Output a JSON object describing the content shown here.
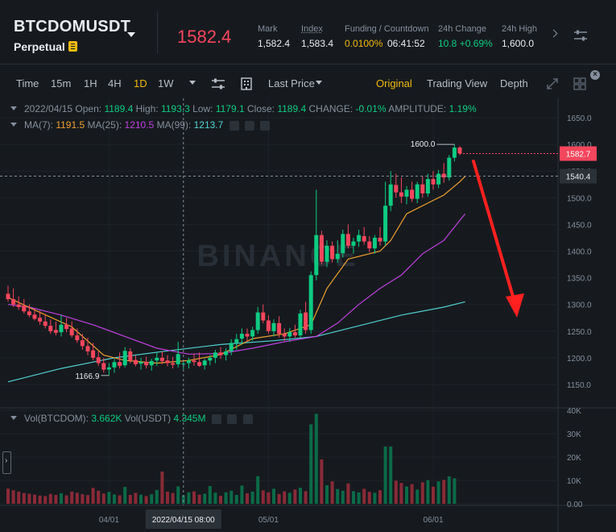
{
  "header": {
    "symbol": "BTCDOMUSDT",
    "contract_type": "Perpetual",
    "last_price": "1582.4",
    "stats": [
      {
        "label": "Mark",
        "value": "1,582.4"
      },
      {
        "label": "Index",
        "value": "1,583.4"
      },
      {
        "label": "Funding / Countdown",
        "value": "0.0100%",
        "value2": "06:41:52"
      },
      {
        "label": "24h Change",
        "value": "10.8 +0.69%"
      },
      {
        "label": "24h High",
        "value": "1,600.0"
      }
    ]
  },
  "toolbar": {
    "intervals": [
      "Time",
      "15m",
      "1H",
      "4H",
      "1D",
      "1W"
    ],
    "active_interval": "1D",
    "price_type": "Last Price",
    "views": [
      "Original",
      "Trading View",
      "Depth"
    ],
    "active_view": "Original"
  },
  "legend": {
    "date": "2022/04/15",
    "open_label": "Open:",
    "open": "1189.4",
    "high_label": "High:",
    "high": "1193.3",
    "low_label": "Low:",
    "low": "1179.1",
    "close_label": "Close:",
    "close": "1189.4",
    "change_label": "CHANGE:",
    "change": "-0.01%",
    "amplitude_label": "AMPLITUDE:",
    "amplitude": "1.19%",
    "ma7_label": "MA(7):",
    "ma7": "1191.5",
    "ma25_label": "MA(25):",
    "ma25": "1210.5",
    "ma99_label": "MA(99):",
    "ma99": "1213.7",
    "vol_label": "Vol(BTCDOM):",
    "vol_btcdom": "3.662K",
    "vol_usdt_label": "Vol(USDT)",
    "vol_usdt": "4.345M"
  },
  "watermark": "BINANCE",
  "markers": {
    "high_label": "1600.0",
    "low_label": "1166.9",
    "current_price_tag": "1582.7",
    "crosshair_price_tag": "1540.4",
    "crosshair_date_tag": "2022/04/15 08:00"
  },
  "colors": {
    "up": "#0ecb81",
    "down": "#f6465d",
    "ma7": "#f0a030",
    "ma25": "#c040e0",
    "ma99": "#50d0d0",
    "annotation_arrow": "#ff2020"
  },
  "chart_data": {
    "type": "candlestick",
    "ylim": [
      1130,
      1670
    ],
    "y_ticks": [
      "1650.0",
      "1600.0",
      "1550.0",
      "1500.0",
      "1450.0",
      "1400.0",
      "1350.0",
      "1300.0",
      "1250.0",
      "1200.0",
      "1150.0"
    ],
    "y_tick_values": [
      1650,
      1600,
      1550,
      1500,
      1450,
      1400,
      1350,
      1300,
      1250,
      1200,
      1150
    ],
    "vol_ticks": [
      "40K",
      "30K",
      "20K",
      "10K",
      "0.00"
    ],
    "vol_tick_values": [
      40000,
      30000,
      20000,
      10000,
      0
    ],
    "x_ticks": [
      {
        "label": "04/01",
        "index": 19
      },
      {
        "label": "05/01",
        "index": 49
      },
      {
        "label": "06/01",
        "index": 80
      }
    ],
    "highlighted_index": 33,
    "candles": [
      [
        1320,
        1335,
        1305,
        1310,
        6500
      ],
      [
        1310,
        1330,
        1295,
        1300,
        5800
      ],
      [
        1300,
        1315,
        1290,
        1295,
        5200
      ],
      [
        1298,
        1310,
        1283,
        1287,
        4600
      ],
      [
        1287,
        1300,
        1276,
        1280,
        4300
      ],
      [
        1281,
        1292,
        1270,
        1273,
        3900
      ],
      [
        1275,
        1288,
        1262,
        1268,
        3500
      ],
      [
        1268,
        1282,
        1255,
        1260,
        3300
      ],
      [
        1260,
        1272,
        1245,
        1250,
        4200
      ],
      [
        1252,
        1268,
        1242,
        1247,
        3800
      ],
      [
        1248,
        1280,
        1240,
        1262,
        4500
      ],
      [
        1262,
        1275,
        1248,
        1254,
        3600
      ],
      [
        1255,
        1268,
        1238,
        1242,
        5200
      ],
      [
        1242,
        1255,
        1228,
        1233,
        4700
      ],
      [
        1233,
        1245,
        1215,
        1222,
        4100
      ],
      [
        1222,
        1238,
        1205,
        1212,
        3700
      ],
      [
        1214,
        1228,
        1195,
        1200,
        6800
      ],
      [
        1201,
        1212,
        1185,
        1190,
        5600
      ],
      [
        1190,
        1200,
        1172,
        1178,
        4400
      ],
      [
        1178,
        1190,
        1167,
        1182,
        5100
      ],
      [
        1182,
        1198,
        1172,
        1192,
        4000
      ],
      [
        1192,
        1210,
        1180,
        1185,
        3600
      ],
      [
        1186,
        1220,
        1182,
        1213,
        7200
      ],
      [
        1212,
        1218,
        1190,
        1195,
        3800
      ],
      [
        1196,
        1205,
        1184,
        1188,
        4700
      ],
      [
        1189,
        1200,
        1178,
        1192,
        3900
      ],
      [
        1192,
        1202,
        1180,
        1186,
        3300
      ],
      [
        1186,
        1198,
        1176,
        1194,
        4100
      ],
      [
        1195,
        1210,
        1185,
        1200,
        5900
      ],
      [
        1200,
        1212,
        1188,
        1194,
        13800
      ],
      [
        1195,
        1205,
        1184,
        1190,
        5200
      ],
      [
        1190,
        1202,
        1180,
        1187,
        4600
      ],
      [
        1188,
        1230,
        1182,
        1207,
        7400
      ],
      [
        1189,
        1193,
        1179,
        1189,
        3662
      ],
      [
        1190,
        1200,
        1180,
        1195,
        4900
      ],
      [
        1195,
        1208,
        1185,
        1192,
        5300
      ],
      [
        1192,
        1210,
        1183,
        1185,
        3900
      ],
      [
        1186,
        1198,
        1178,
        1195,
        4300
      ],
      [
        1195,
        1205,
        1186,
        1200,
        7600
      ],
      [
        1200,
        1215,
        1190,
        1210,
        4800
      ],
      [
        1210,
        1220,
        1198,
        1205,
        3400
      ],
      [
        1205,
        1218,
        1195,
        1212,
        4900
      ],
      [
        1212,
        1235,
        1205,
        1228,
        5600
      ],
      [
        1228,
        1245,
        1215,
        1235,
        3800
      ],
      [
        1236,
        1255,
        1225,
        1245,
        7800
      ],
      [
        1245,
        1255,
        1230,
        1240,
        4500
      ],
      [
        1240,
        1258,
        1232,
        1252,
        5200
      ],
      [
        1252,
        1295,
        1245,
        1285,
        11800
      ],
      [
        1285,
        1300,
        1265,
        1270,
        5800
      ],
      [
        1270,
        1280,
        1245,
        1250,
        4900
      ],
      [
        1250,
        1272,
        1240,
        1265,
        6400
      ],
      [
        1265,
        1278,
        1238,
        1245,
        4200
      ],
      [
        1245,
        1255,
        1232,
        1240,
        5300
      ],
      [
        1240,
        1256,
        1230,
        1248,
        4700
      ],
      [
        1248,
        1262,
        1238,
        1242,
        6100
      ],
      [
        1242,
        1290,
        1238,
        1283,
        6900
      ],
      [
        1285,
        1305,
        1245,
        1252,
        5400
      ],
      [
        1252,
        1362,
        1245,
        1355,
        34000
      ],
      [
        1355,
        1515,
        1345,
        1430,
        38500
      ],
      [
        1430,
        1438,
        1375,
        1380,
        19000
      ],
      [
        1380,
        1420,
        1370,
        1410,
        7900
      ],
      [
        1410,
        1418,
        1378,
        1385,
        9600
      ],
      [
        1385,
        1420,
        1378,
        1395,
        6300
      ],
      [
        1396,
        1440,
        1388,
        1432,
        5600
      ],
      [
        1432,
        1450,
        1405,
        1410,
        8700
      ],
      [
        1410,
        1425,
        1395,
        1418,
        5400
      ],
      [
        1418,
        1440,
        1408,
        1430,
        4900
      ],
      [
        1428,
        1445,
        1412,
        1418,
        6400
      ],
      [
        1418,
        1428,
        1398,
        1405,
        5100
      ],
      [
        1405,
        1430,
        1395,
        1425,
        4700
      ],
      [
        1425,
        1445,
        1410,
        1418,
        5800
      ],
      [
        1418,
        1530,
        1410,
        1485,
        24500
      ],
      [
        1485,
        1550,
        1475,
        1525,
        24500
      ],
      [
        1524,
        1545,
        1500,
        1510,
        9900
      ],
      [
        1510,
        1538,
        1490,
        1502,
        8900
      ],
      [
        1502,
        1522,
        1488,
        1515,
        7400
      ],
      [
        1515,
        1530,
        1492,
        1498,
        8400
      ],
      [
        1498,
        1530,
        1490,
        1525,
        6100
      ],
      [
        1525,
        1540,
        1500,
        1508,
        9200
      ],
      [
        1508,
        1545,
        1502,
        1535,
        10100
      ],
      [
        1535,
        1550,
        1515,
        1525,
        7300
      ],
      [
        1525,
        1552,
        1518,
        1545,
        9600
      ],
      [
        1545,
        1565,
        1528,
        1538,
        10200
      ],
      [
        1538,
        1580,
        1532,
        1575,
        11700
      ],
      [
        1575,
        1600,
        1568,
        1594,
        10900
      ],
      [
        1594,
        1597,
        1580,
        1583,
        0
      ]
    ],
    "ma7": [
      [
        0,
        1313
      ],
      [
        6,
        1285
      ],
      [
        12,
        1258
      ],
      [
        18,
        1205
      ],
      [
        22,
        1195
      ],
      [
        28,
        1190
      ],
      [
        34,
        1195
      ],
      [
        40,
        1206
      ],
      [
        46,
        1236
      ],
      [
        52,
        1245
      ],
      [
        57,
        1262
      ],
      [
        60,
        1330
      ],
      [
        64,
        1385
      ],
      [
        70,
        1400
      ],
      [
        72,
        1420
      ],
      [
        75,
        1470
      ],
      [
        79,
        1490
      ],
      [
        82,
        1505
      ],
      [
        85,
        1530
      ],
      [
        86,
        1540
      ]
    ],
    "ma25": [
      [
        0,
        1300
      ],
      [
        4,
        1295
      ],
      [
        10,
        1280
      ],
      [
        16,
        1262
      ],
      [
        22,
        1240
      ],
      [
        28,
        1218
      ],
      [
        34,
        1207
      ],
      [
        40,
        1208
      ],
      [
        46,
        1218
      ],
      [
        52,
        1230
      ],
      [
        58,
        1240
      ],
      [
        62,
        1265
      ],
      [
        66,
        1300
      ],
      [
        70,
        1330
      ],
      [
        74,
        1355
      ],
      [
        78,
        1395
      ],
      [
        82,
        1420
      ],
      [
        86,
        1470
      ]
    ],
    "ma99": [
      [
        0,
        1155
      ],
      [
        10,
        1180
      ],
      [
        20,
        1200
      ],
      [
        30,
        1213
      ],
      [
        40,
        1225
      ],
      [
        50,
        1232
      ],
      [
        58,
        1240
      ],
      [
        66,
        1260
      ],
      [
        74,
        1280
      ],
      [
        82,
        1295
      ],
      [
        86,
        1305
      ]
    ]
  }
}
